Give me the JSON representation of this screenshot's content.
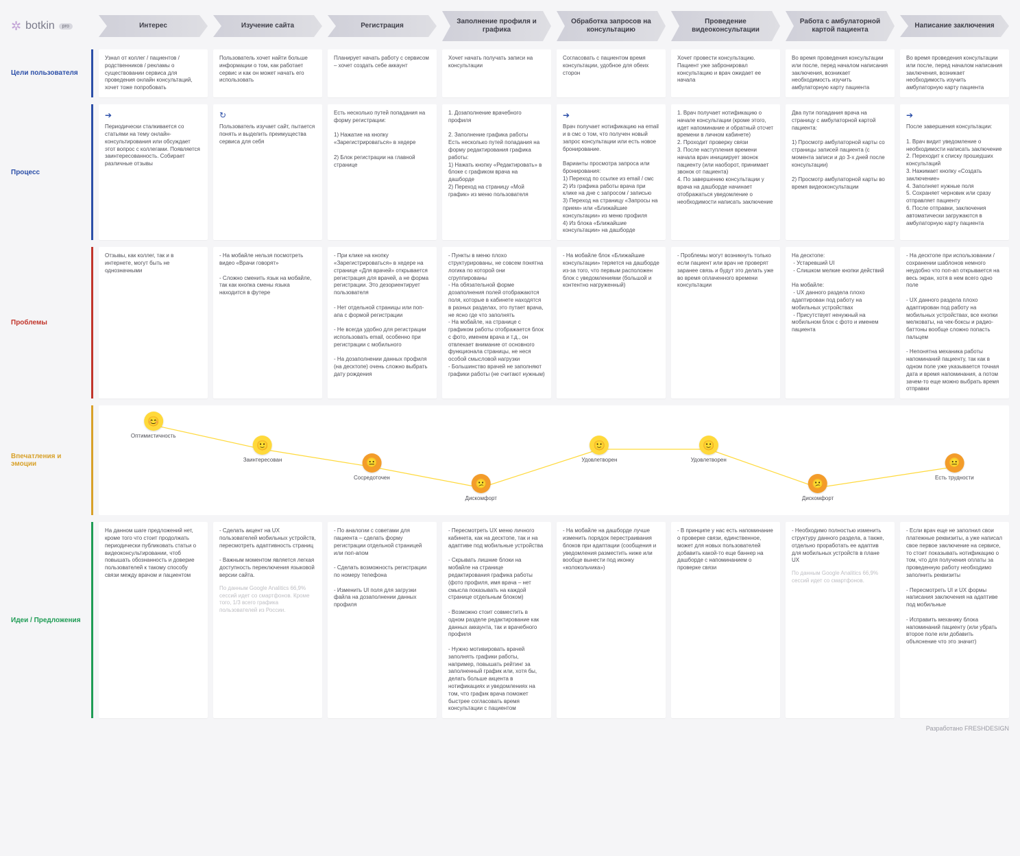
{
  "brand": {
    "name": "botkin",
    "sup": "pro"
  },
  "stages": [
    "Интерес",
    "Изучение сайта",
    "Регистрация",
    "Заполнение профиля и графика",
    "Обработка запросов на консультацию",
    "Проведение видеоконсультации",
    "Работа с амбулаторной картой пациента",
    "Написание заключения"
  ],
  "rows": {
    "goals": {
      "label": "Цели пользователя",
      "cells": [
        "Узнал от коллег / пациентов / родственников / рекламы о существовании сервиса для проведения онлайн консультаций, хочет тоже попробовать",
        "Пользователь хочет найти больше информации о том, как работает сервис и как он может начать его использовать",
        "Планирует начать работу с сервисом – хочет создать себе аккаунт",
        "Хочет начать получать записи на консультации",
        "Согласовать с пациентом время консультации, удобное для обеих сторон",
        "Хочет провести консультацию. Пациент уже забронировал консультацию и врач ожидает ее начала",
        "Во время проведения консультации или после, перед началом написания заключения, возникает необходимость изучить амбулаторную карту пациента",
        "Во время проведения консультации или после, перед началом написания заключения, возникает необходимость изучить амбулаторную карту пациента"
      ]
    },
    "process": {
      "label": "Процесс",
      "icons": [
        "arrow",
        "reload",
        "",
        "",
        "arrow",
        "",
        "",
        "arrow"
      ],
      "cells": [
        "Периодически сталкивается со статьями на тему онлайн-консультирования или обсуждает этот вопрос с коллегами. Появляется заинтересованность. Собирает различные отзывы",
        "Пользователь изучает сайт, пытается понять и выделить преимущества сервиса для себя",
        "Есть несколько путей попадания на форму регистрации:\n\n1) Нажатие на кнопку «Зарегистрироваться» в хедере\n\n2) Блок регистрации на главной странице",
        "1. Дозаполнение врачебного профиля\n\n2. Заполнение графика работы\nЕсть несколько путей попадания на форму редактирования графика работы:\n1) Нажать кнопку «Редактировать» в блоке с графиком врача на дашборде\n2) Переход на страницу «Мой график» из меню пользователя",
        "Врач получает нотификацию на email и в смс о том, что получен новый запрос консультации или есть новое бронирование.\n\nВарианты просмотра запроса или бронирования:\n1) Переход по ссылке из email / смс\n2) Из графика работы врача при клике на дне с запросом / записью\n3) Переход на страницу «Запросы на прием» или «Ближайшие консультации» из меню профиля\n4) Из блока «Ближайшие консультации» на дашборде",
        "1. Врач получает нотификацию о начале консультации (кроме этого, идет напоминание и обратный отсчет времени в личном кабинете)\n2. Проходит проверку связи\n3. После наступления времени начала врач инициирует звонок пациенту (или наоборот, принимает звонок от пациента)\n4. По завершению консультации у врача на дашборде начинает отображаться уведомление о необходимости написать заключение",
        "Два пути попадания врача на страницу с амбулаторной картой пациента:\n\n1) Просмотр амбулаторной карты со страницы записей пациента (с момента записи и до 3-х дней после консультации)\n\n2) Просмотр амбулаторной карты во время видеоконсультации",
        "После завершения консультации:\n\n1. Врач видит уведомление о необходимости написать заключение\n2. Переходит к списку прошедших консультаций\n3. Нажимает кнопку «Создать заключение»\n4. Заполняет нужные поля\n5. Сохраняет черновик или сразу отправляет пациенту\n6. После отправки, заключения автоматически загружаются в амбулаторную карту пациента"
      ]
    },
    "problems": {
      "label": "Проблемы",
      "cells": [
        "Отзывы, как коллег, так и в интернете, могут быть не однозначными",
        "- На мобайле нельзя посмотреть видео «Врачи говорят»\n\n- Сложно сменить язык на мобайле, так как кнопка смены языка находится в футере",
        "- При клике на кнопку «Зарегистрироваться» в хедере на странице «Для врачей» открывается регистрация для врачей, а не форма регистрации. Это дезориентирует пользователя\n\n- Нет отдельной страницы или поп-апа с формой регистрации\n\n- Не всегда удобно для регистрации использовать email, особенно при регистрации с мобильного\n\n- На дозаполнении данных профиля (на десктопе) очень сложно выбрать дату рождения",
        "- Пункты в меню плохо структурированы, не совсем понятна логика по которой они сгруппированы\n- На обязательной форме дозаполнения полей отображаются поля, которые в кабинете находятся в разных разделах, это путает врача, не ясно где что заполнять\n- На мобайле, на странице с графиком работы отображается блок с фото, именем врача и т.д., он отвлекает внимание от основного функционала страницы, не неся особой смысловой нагрузки\n- Большинство врачей не заполняют графики работы (не считают нужным)",
        "- На мобайле блок «Ближайшие консультации» теряется на дашборде из-за того, что первым расположен блок с уведомлениями (большой и контентно нагруженный)",
        "- Проблемы могут возникнуть только если пациент или врач не проверят заранее связь и будут это делать уже во время оплаченного времени консультации",
        "На десктопе:\n - Устаревший UI\n - Слишком мелкие кнопки действий\n\nНа мобайле:\n - UX данного раздела плохо адаптирован под работу на мобильных устройствах\n - Присутствует ненужный на мобильном блок с фото и именем пациента",
        "- На десктопе при использовании / сохранении шаблонов немного неудобно что поп-ап открывается на весь экран, хотя в нем всего одно поле\n\n- UX данного раздела плохо адаптирован под работу на мобильных устройствах, все кнопки мелковаты, на чек-боксы и радио-баттоны вообще сложно попасть пальцем\n\n- Непонятна механика работы напоминаний пациенту, так как в одном поле уже указывается точная дата и время напоминания, а потом зачем-то еще можно выбрать время отправки"
      ]
    },
    "emotions": {
      "label": "Впечатления и эмоции",
      "points": [
        {
          "label": "Оптимистичность",
          "mood": "happy",
          "x": 6,
          "y": 18
        },
        {
          "label": "Заинтересован",
          "mood": "smile",
          "x": 18,
          "y": 40
        },
        {
          "label": "Сосредоточен",
          "mood": "neutral",
          "x": 30,
          "y": 56
        },
        {
          "label": "Дискомфорт",
          "mood": "meh",
          "x": 42,
          "y": 75
        },
        {
          "label": "Удовлетворен",
          "mood": "smile",
          "x": 55,
          "y": 40
        },
        {
          "label": "Удовлетворен",
          "mood": "smile",
          "x": 67,
          "y": 40
        },
        {
          "label": "Дискомфорт",
          "mood": "meh",
          "x": 79,
          "y": 75
        },
        {
          "label": "Есть трудности",
          "mood": "neutral",
          "x": 94,
          "y": 56
        }
      ]
    },
    "ideas": {
      "label": "Идеи / Предложения",
      "cells": [
        "На данном шаге предложений нет, кроме того что стоит продолжать периодически публиковать статьи о видеоконсультировании, чтоб повышать обознанность и доверие пользователей к такому способу связи между врачом и пациентом",
        "- Сделать акцент на UX пользователей мобильных устройств, пересмотреть адаптивность страниц\n\n- Важным моментом является легкая доступность переключения языковой версии сайта.",
        "- По аналогии с советами для пациента – сделать форму регистрации отдельной страницей или поп-апом\n\n- Сделать возможность регистрации по номеру телефона\n\n- Изменить UI поля для загрузки файла на дозаполнении данных профиля",
        "- Пересмотреть UX меню личного кабинета, как на десктопе, так и на адаптиве под мобильные устройства\n\n- Скрывать лишние блоки на мобайле на странице редактирования графика работы (фото профиля, имя врача – нет смысла показывать на каждой странице отдельным блоком)\n\n- Возможно стоит совместить в одном разделе редактирование как данных аккаунта, так и врачебного профиля\n\n- Нужно мотивировать врачей заполнять графики работы, например, повышать рейтинг за заполненный график или, хотя бы, делать больше акцента в нотификациях и уведомлениях на том, что график врача поможет быстрее согласовать время консультации с пациентом",
        "- На мобайле на дашборде лучше изменить порядок перестраивания блоков при адаптации (сообщения и уведомления разместить ниже или вообще вынести под иконку «колокольчика»)",
        "- В принципе у нас есть напоминание о проверке связи, единственное, может для новых пользователей добавить какой-то еще баннер на дашборде с напоминанием о проверке связи",
        "- Необходимо полностью изменить структуру данного раздела, а также, отдельно проработать ее адаптив для мобильных устройств в плане UX",
        "- Если врач еще не заполнил свои платежные реквизиты, а уже написал свое первое заключение на сервисе, то стоит показывать нотификацию о том, что для получения оплаты за проведенную работу необходимо заполнить реквизиты\n\n- Пересмотреть UI и UX формы написания заключения на адаптиве под мобильные\n\n- Исправить механику блока напоминаний пациенту (или убрать второе поле или добавить объяснение что это значит)"
      ],
      "notes": {
        "1": "По данным Google Analitics 66,9% сессий идет со смартфонов. Кроме того, 1/3 всего графика пользователей из России.",
        "6": "По данным Google Analitics 66,9% сессий идет со смартфонов."
      }
    }
  },
  "credit": "Разработано FRESHDESIGN"
}
